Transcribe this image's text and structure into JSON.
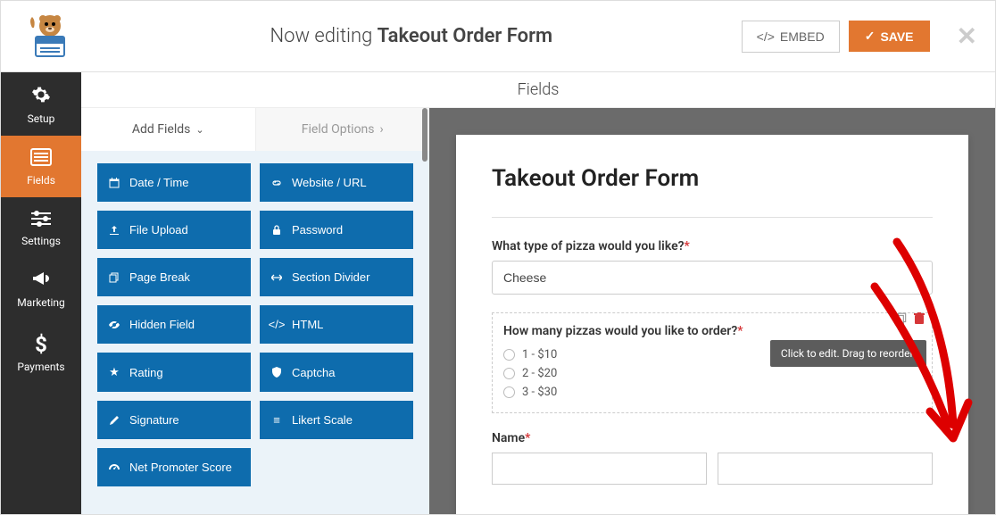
{
  "header": {
    "editing_prefix": "Now editing",
    "editing_title": "Takeout Order Form",
    "embed_label": "EMBED",
    "save_label": "SAVE"
  },
  "sidebar": {
    "items": [
      {
        "icon": "gear",
        "label": "Setup"
      },
      {
        "icon": "list",
        "label": "Fields"
      },
      {
        "icon": "sliders",
        "label": "Settings"
      },
      {
        "icon": "bullhorn",
        "label": "Marketing"
      },
      {
        "icon": "dollar",
        "label": "Payments"
      }
    ]
  },
  "main_header": "Fields",
  "panel": {
    "tab_add": "Add Fields",
    "tab_options": "Field Options",
    "fields": [
      {
        "icon": "calendar",
        "label": "Date / Time"
      },
      {
        "icon": "link",
        "label": "Website / URL"
      },
      {
        "icon": "upload",
        "label": "File Upload"
      },
      {
        "icon": "lock",
        "label": "Password"
      },
      {
        "icon": "copy",
        "label": "Page Break"
      },
      {
        "icon": "arrows",
        "label": "Section Divider"
      },
      {
        "icon": "eye-slash",
        "label": "Hidden Field"
      },
      {
        "icon": "code",
        "label": "HTML"
      },
      {
        "icon": "star",
        "label": "Rating"
      },
      {
        "icon": "shield",
        "label": "Captcha"
      },
      {
        "icon": "pencil",
        "label": "Signature"
      },
      {
        "icon": "bars",
        "label": "Likert Scale"
      },
      {
        "icon": "tachometer",
        "label": "Net Promoter Score"
      }
    ]
  },
  "form": {
    "title": "Takeout Order Form",
    "pizza_type_label": "What type of pizza would you like?",
    "pizza_type_value": "Cheese",
    "qty_label": "How many pizzas would you like to order?",
    "qty_options": [
      "1 - $10",
      "2 - $20",
      "3 - $30"
    ],
    "name_label": "Name",
    "tooltip": "Click to edit. Drag to reorder."
  },
  "icons": {
    "gear": "⚙",
    "list": "▤",
    "sliders": "⚙",
    "bullhorn": "📣",
    "dollar": "$",
    "chevron_down": "⌄",
    "chevron_right": "›",
    "check": "✓",
    "close": "✕"
  }
}
